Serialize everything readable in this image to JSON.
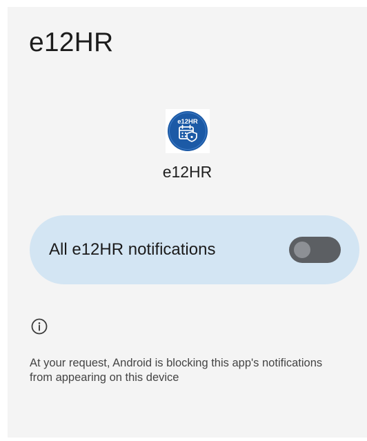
{
  "page": {
    "title": "e12HR"
  },
  "app": {
    "icon_name": "e12hr-app-icon",
    "icon_text": "e12HR",
    "name": "e12HR",
    "brand_color": "#1c5aa6"
  },
  "notifications": {
    "toggle_label": "All e12HR notifications",
    "enabled": false,
    "card_color": "#d3e5f3"
  },
  "info": {
    "icon_name": "info-icon",
    "text": "At your request, Android is blocking this app's notifications from appearing on this device"
  }
}
